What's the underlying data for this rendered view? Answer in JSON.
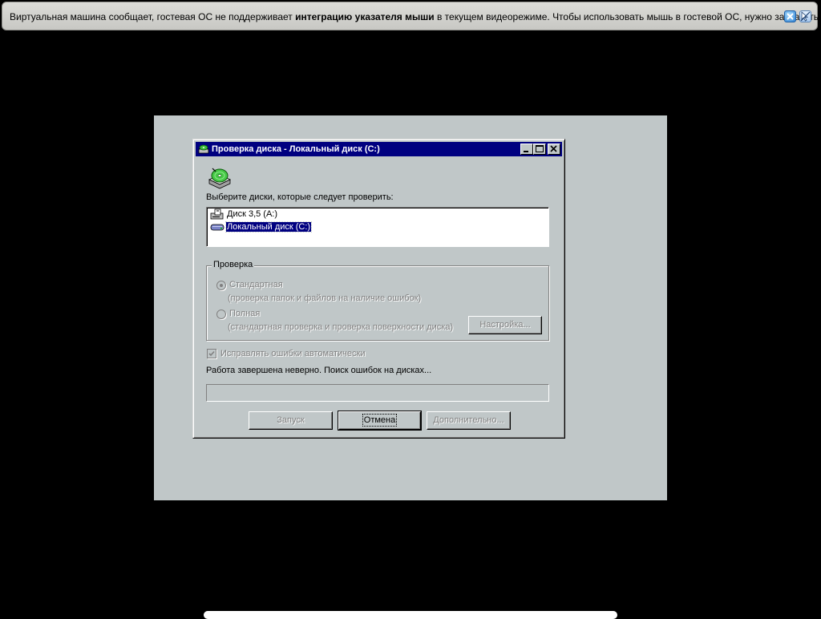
{
  "notification": {
    "text_before": "Виртуальная машина сообщает, гостевая ОС не поддерживает ",
    "text_bold": "интеграцию указателя мыши",
    "text_after": " в текущем видеорежиме. Чтобы использовать мышь в гостевой ОС, нужно захватить",
    "close_icon": "close-icon",
    "dont_show_icon": "no-pointer-icon"
  },
  "dialog": {
    "title": "Проверка диска - Локальный диск (C:)",
    "select_label": "Выберите диски, которые следует проверить:",
    "drives": [
      {
        "label": "Диск 3,5 (A:)",
        "icon": "floppy-drive-icon",
        "selected": false
      },
      {
        "label": "Локальный диск (C:)",
        "icon": "hard-drive-icon",
        "selected": true
      }
    ],
    "check_group": {
      "label": "Проверка",
      "standard": {
        "label": "Стандартная",
        "description": "(проверка папок и файлов на наличие ошибок)",
        "selected": true,
        "enabled": false
      },
      "full": {
        "label": "Полная",
        "description": "(стандартная проверка и проверка поверхности диска)",
        "selected": false,
        "enabled": false
      },
      "settings_button": "Настройка..."
    },
    "auto_fix": {
      "label": "Исправлять ошибки автоматически",
      "checked": true,
      "enabled": false
    },
    "status_text": "Работа завершена неверно. Поиск ошибок на дисках...",
    "progress": 0,
    "buttons": {
      "start": "Запуск",
      "cancel": "Отмена",
      "advanced": "Дополнительно..."
    }
  },
  "colors": {
    "title_bar": "#000080",
    "face": "#c0c7c8",
    "desktop_background": "#000000"
  }
}
